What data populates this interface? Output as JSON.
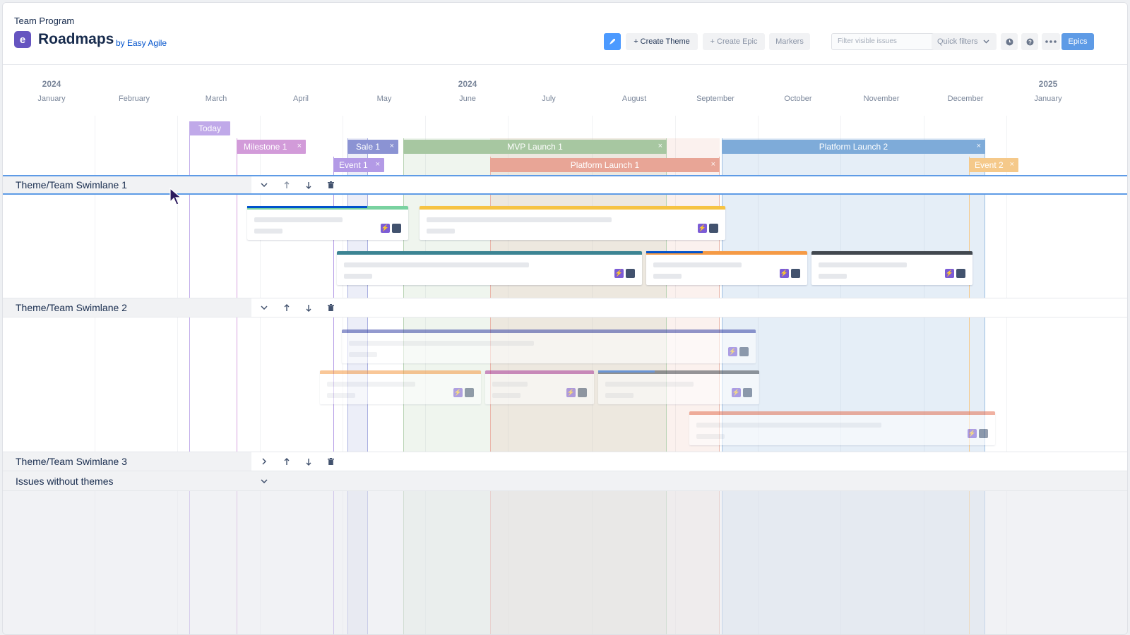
{
  "header": {
    "project": "Team Program",
    "logo_letter": "e",
    "title": "Roadmaps",
    "byline": "by Easy Agile"
  },
  "toolbar": {
    "create_theme": "+  Create Theme",
    "create_epic": "+  Create Epic",
    "markers": "Markers",
    "filter_placeholder": "Filter visible issues",
    "quick_filters": "Quick filters",
    "epics": "Epics"
  },
  "timeline": {
    "years": [
      "2024",
      "2024",
      "2025"
    ],
    "months": [
      "January",
      "February",
      "March",
      "April",
      "May",
      "June",
      "July",
      "August",
      "September",
      "October",
      "November",
      "December",
      "January"
    ]
  },
  "markers": {
    "today": "Today",
    "milestone1": "Milestone 1",
    "sale1": "Sale 1",
    "event1": "Event 1",
    "mvp_launch1": "MVP Launch 1",
    "platform_launch1": "Platform Launch 1",
    "platform_launch2": "Platform Launch 2",
    "event2": "Event 2",
    "close_glyph": "×"
  },
  "swimlanes": [
    {
      "title": "Theme/Team Swimlane 1",
      "expanded": true
    },
    {
      "title": "Theme/Team Swimlane 2",
      "expanded": true
    },
    {
      "title": "Theme/Team Swimlane 3",
      "expanded": false
    },
    {
      "title": "Issues without themes",
      "expanded": true
    }
  ],
  "colors": {
    "today": "#c0a9e9",
    "milestone": "#c58fcf",
    "sale": "#8b93d3",
    "event1": "#b39ae6",
    "mvp": "#a7c7a1",
    "platform1": "#e8a596",
    "platform2": "#7eabd9",
    "event2": "#f5c98a",
    "accent": "#5e9be6"
  }
}
